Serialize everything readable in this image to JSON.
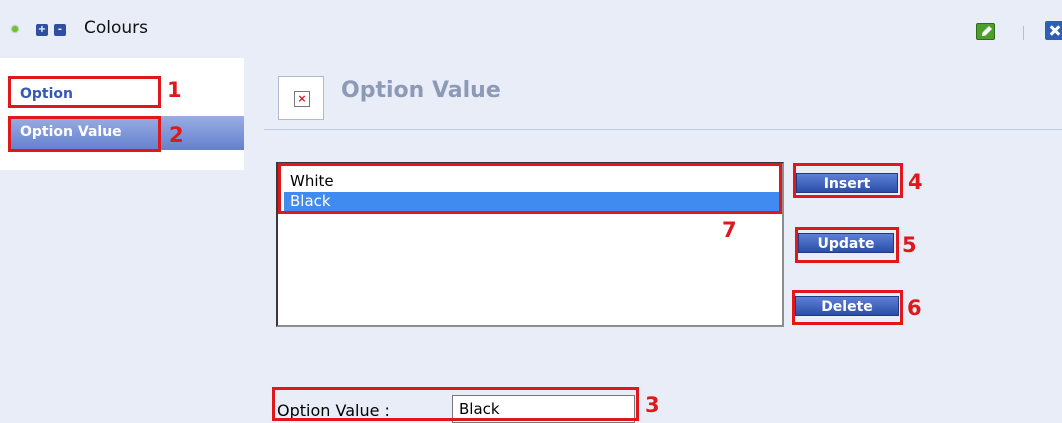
{
  "header": {
    "title": "Colours",
    "buttons": {
      "expand": "+",
      "collapse": "-"
    }
  },
  "sidebar": {
    "items": [
      {
        "label": "Option"
      },
      {
        "label": "Option Value"
      }
    ]
  },
  "main": {
    "title": "Option Value",
    "list": {
      "items": [
        "White",
        "Black"
      ],
      "selected_index": 1
    },
    "buttons": {
      "insert": "Insert",
      "update": "Update",
      "delete": "Delete"
    },
    "option_value_field": {
      "label": "Option Value :",
      "value": "Black"
    }
  },
  "annotations": [
    "1",
    "2",
    "3",
    "4",
    "5",
    "6",
    "7"
  ],
  "colors": {
    "accent": "#2a4ea9",
    "annotation": "#e0181b",
    "selection": "#3f8bf0",
    "background": "#e9edf8"
  },
  "icons": [
    "status-dot-icon",
    "expand-icon",
    "collapse-icon",
    "edit-icon",
    "close-icon",
    "broken-image-icon"
  ]
}
